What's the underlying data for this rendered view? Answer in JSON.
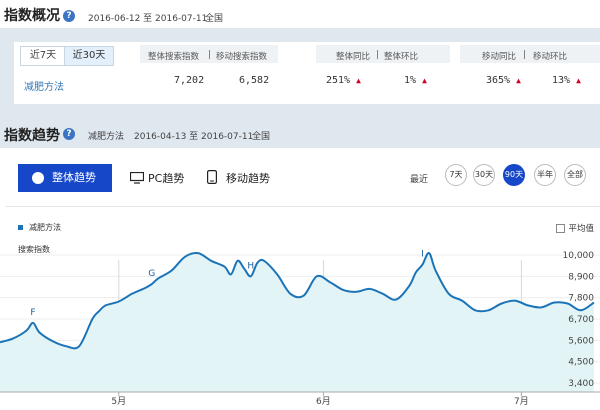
{
  "overview": {
    "title": "指数概况",
    "date_range": "2016-06-12 至 2016-07-11",
    "region": "全国",
    "tabs": [
      "近7天",
      "近30天"
    ],
    "active_tab": "近30天",
    "headers": {
      "overall_index": "整体搜索指数",
      "sep": "|",
      "mobile_index": "移动搜索指数",
      "overall_yoy": "整体同比",
      "overall_mom": "整体环比",
      "mobile_yoy": "移动同比",
      "mobile_mom": "移动环比"
    },
    "row": {
      "keyword": "减肥方法",
      "overall_index": "7,202",
      "mobile_index": "6,582",
      "overall_yoy": "251%",
      "overall_mom": "1%",
      "mobile_yoy": "365%",
      "mobile_mom": "13%",
      "arrow": "▲"
    }
  },
  "trend": {
    "title": "指数趋势",
    "keyword": "减肥方法",
    "date_range": "2016-04-13 至 2016-07-11",
    "region": "全国",
    "modes": {
      "all": "整体趋势",
      "pc": "PC趋势",
      "mobile": "移动趋势"
    },
    "recent_label": "最近",
    "periods": [
      "7天",
      "30天",
      "90天",
      "半年",
      "全部"
    ],
    "active_period": "90天",
    "legend": "减肥方法",
    "y_title": "搜索指数",
    "average_label": "平均值",
    "accent_color": "#1547c8",
    "line_color": "#1b74b7"
  },
  "chart_data": {
    "type": "area",
    "ylabel": "搜索指数",
    "y_ticks": [
      "10,000",
      "8,900",
      "7,800",
      "6,700",
      "5,600",
      "4,500",
      "3,400"
    ],
    "y_tick_values": [
      10000,
      8900,
      7800,
      6700,
      5600,
      4500,
      3400
    ],
    "ylim": [
      3400,
      10000
    ],
    "x_tick_labels": [
      "5月",
      "6月",
      "7月"
    ],
    "x_tick_days": [
      18,
      49,
      79
    ],
    "annotations": [
      "F",
      "G",
      "H",
      "I"
    ],
    "annotation_days": [
      5,
      23,
      38,
      64
    ],
    "series": [
      {
        "name": "减肥方法",
        "days": [
          0,
          2,
          4,
          5,
          6,
          8,
          10,
          12,
          14,
          15,
          16,
          18,
          20,
          22,
          23,
          24,
          26,
          28,
          30,
          32,
          34,
          35,
          36,
          37,
          38,
          39,
          40,
          42,
          44,
          46,
          48,
          50,
          52,
          54,
          56,
          58,
          60,
          62,
          63,
          64,
          65,
          66,
          68,
          70,
          72,
          74,
          76,
          78,
          80,
          82,
          84,
          86,
          88,
          90
        ],
        "values": [
          5500,
          5700,
          6100,
          6500,
          6000,
          5550,
          5300,
          5300,
          6700,
          7100,
          7400,
          7600,
          8000,
          8300,
          8500,
          8800,
          9200,
          9900,
          10100,
          9700,
          9400,
          9000,
          9700,
          9300,
          8900,
          9600,
          9700,
          9000,
          8000,
          7900,
          8900,
          8600,
          8200,
          8100,
          8250,
          8000,
          7700,
          8400,
          9100,
          9500,
          10100,
          9200,
          8000,
          7650,
          7150,
          7150,
          7500,
          7650,
          7400,
          7300,
          7550,
          7500,
          7150,
          7550
        ]
      }
    ]
  }
}
